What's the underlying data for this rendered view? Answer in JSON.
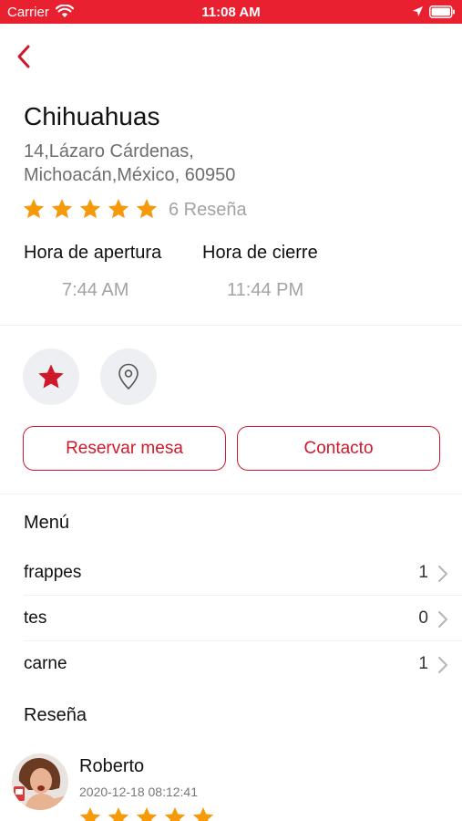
{
  "status_bar": {
    "carrier": "Carrier",
    "time": "11:08 AM",
    "background": "#e8202f"
  },
  "restaurant": {
    "name": "Chihuahuas",
    "address_line1": "14,Lázaro Cárdenas,",
    "address_line2": "Michoacán,México, 60950",
    "rating": 5,
    "review_count_label": "6 Reseña"
  },
  "hours": {
    "open_label": "Hora de apertura",
    "open_value": "7:44 AM",
    "close_label": "Hora de cierre",
    "close_value": "11:44 PM"
  },
  "actions": {
    "favorite_icon": "star-icon",
    "location_icon": "location-pin-icon",
    "reserve_label": "Reservar mesa",
    "contact_label": "Contacto"
  },
  "menu": {
    "title": "Menú",
    "items": [
      {
        "name": "frappes",
        "count": "1"
      },
      {
        "name": "tes",
        "count": "0"
      },
      {
        "name": "carne",
        "count": "1"
      }
    ]
  },
  "reviews": {
    "title": "Reseña",
    "items": [
      {
        "author": "Roberto",
        "date": "2020-12-18 08:12:41",
        "rating": 5
      }
    ]
  },
  "colors": {
    "accent": "#d0182b",
    "star": "#f59a0a",
    "muted": "#a3a3a3"
  }
}
